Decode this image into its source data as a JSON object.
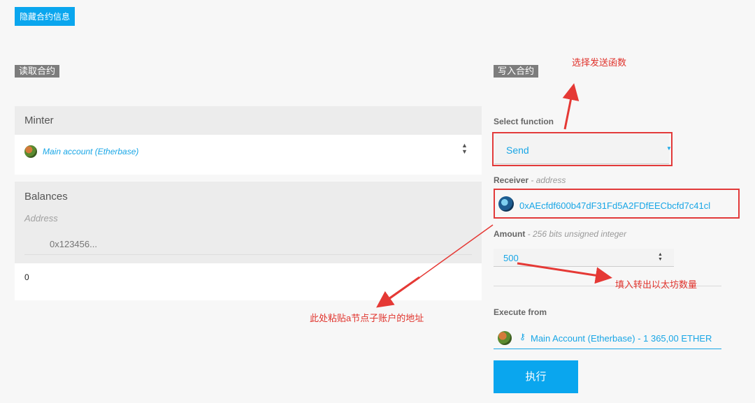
{
  "hide_button_label": "隐藏合约信息",
  "read": {
    "section_title": "读取合约",
    "minter": {
      "title": "Minter",
      "value": "Main account (Etherbase)"
    },
    "balances": {
      "title": "Balances",
      "address_label": "Address",
      "address_placeholder": "0x123456...",
      "result": "0"
    }
  },
  "write": {
    "section_title": "写入合约",
    "select_function_label": "Select function",
    "selected_function": "Send",
    "receiver_label": "Receiver",
    "receiver_type": "- address",
    "receiver_value": "0xAEcfdf600b47dF31Fd5A2FDfEECbcfd7c41cl",
    "amount_label": "Amount",
    "amount_type": "- 256 bits unsigned integer",
    "amount_value": "500",
    "execute_from_label": "Execute from",
    "execute_from_value": "Main Account (Etherbase) - 1 365,00 ETHER",
    "execute_button": "执行"
  },
  "annotations": {
    "select_send": "选择发送函数",
    "amount_note": "填入转出以太坊数量",
    "paste_note": "此处粘贴a节点子账户的地址"
  },
  "colors": {
    "accent": "#0aa6ee",
    "link_blue": "#18a6e6",
    "annotation_red": "#e0332c"
  }
}
